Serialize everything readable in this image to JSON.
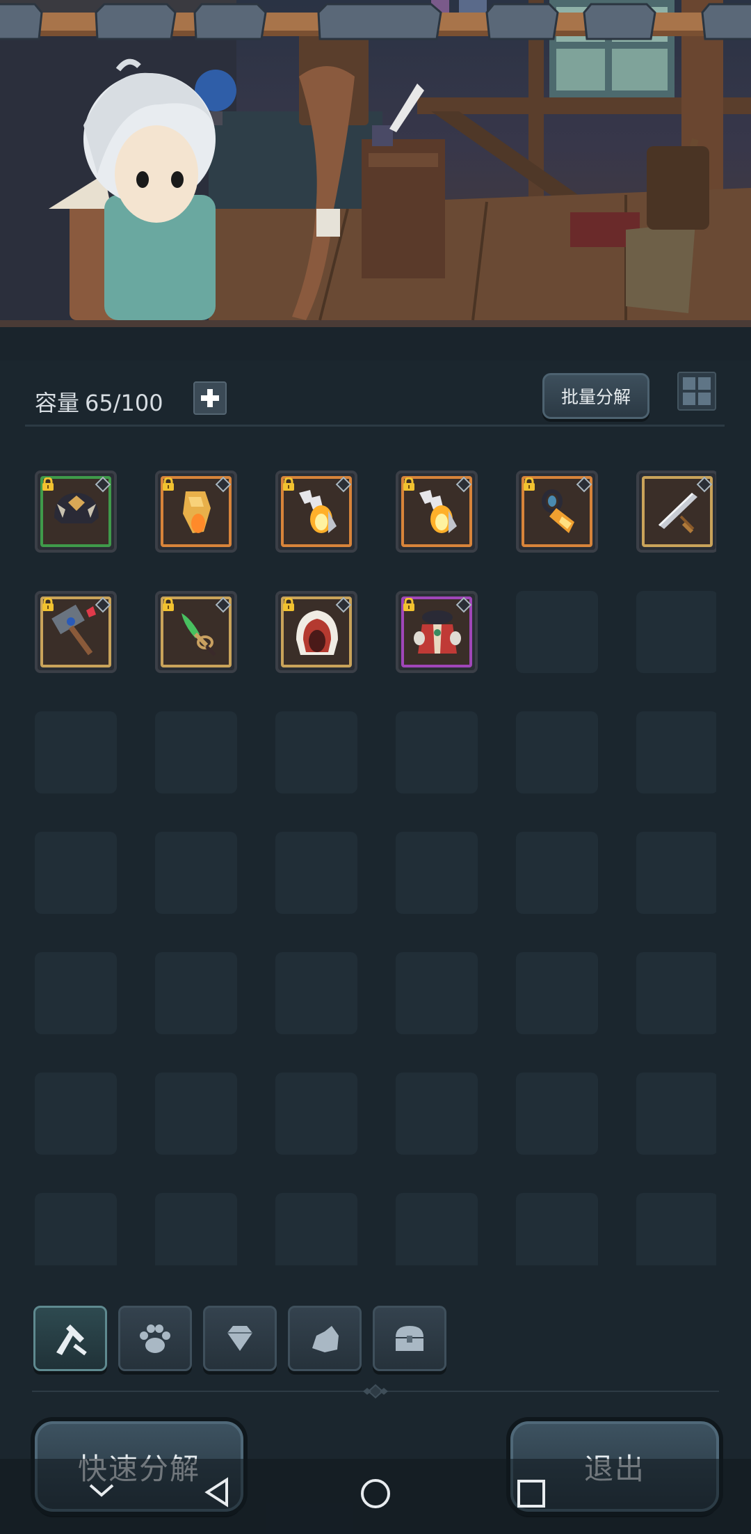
{
  "header": {
    "capacity_label": "容量",
    "capacity_value": "65/100",
    "batch_button": "批量分解"
  },
  "inventory": {
    "items": [
      {
        "name": "dark-crown-helmet",
        "icon": "helmet-icon",
        "rarity_color": "#3f9a4a",
        "locked": true
      },
      {
        "name": "golden-gauntlet",
        "icon": "gauntlet-icon",
        "rarity_color": "#d8843a",
        "locked": true
      },
      {
        "name": "flame-boots-a",
        "icon": "flame-boot-icon",
        "rarity_color": "#d8843a",
        "locked": true
      },
      {
        "name": "flame-boots-b",
        "icon": "flame-boot-icon",
        "rarity_color": "#d8843a",
        "locked": true
      },
      {
        "name": "golden-bracer",
        "icon": "bracer-icon",
        "rarity_color": "#d8843a",
        "locked": true
      },
      {
        "name": "steel-sword",
        "icon": "sword-icon",
        "rarity_color": "#c9a35a",
        "locked": false
      },
      {
        "name": "war-hammer",
        "icon": "hammer-icon",
        "rarity_color": "#c9a35a",
        "locked": true
      },
      {
        "name": "emerald-dagger",
        "icon": "dagger-icon",
        "rarity_color": "#c9a35a",
        "locked": true
      },
      {
        "name": "red-hood",
        "icon": "hood-icon",
        "rarity_color": "#c9a35a",
        "locked": true
      },
      {
        "name": "crimson-robe",
        "icon": "robe-icon",
        "rarity_color": "#a046b8",
        "locked": true
      }
    ],
    "total_slots": 42
  },
  "tabs": [
    {
      "name": "equipment",
      "icon": "weapons-icon",
      "active": true
    },
    {
      "name": "pets",
      "icon": "paw-icon",
      "active": false
    },
    {
      "name": "gems",
      "icon": "diamond-icon",
      "active": false
    },
    {
      "name": "materials",
      "icon": "ore-icon",
      "active": false
    },
    {
      "name": "chests",
      "icon": "chest-icon",
      "active": false
    }
  ],
  "footer": {
    "quick_decompose": "快速分解",
    "exit": "退出"
  },
  "colors": {
    "background": "#1b262e",
    "empty_slot": "#212e37",
    "legendary": "#d8843a",
    "epic": "#a046b8",
    "uncommon": "#3f9a4a"
  }
}
